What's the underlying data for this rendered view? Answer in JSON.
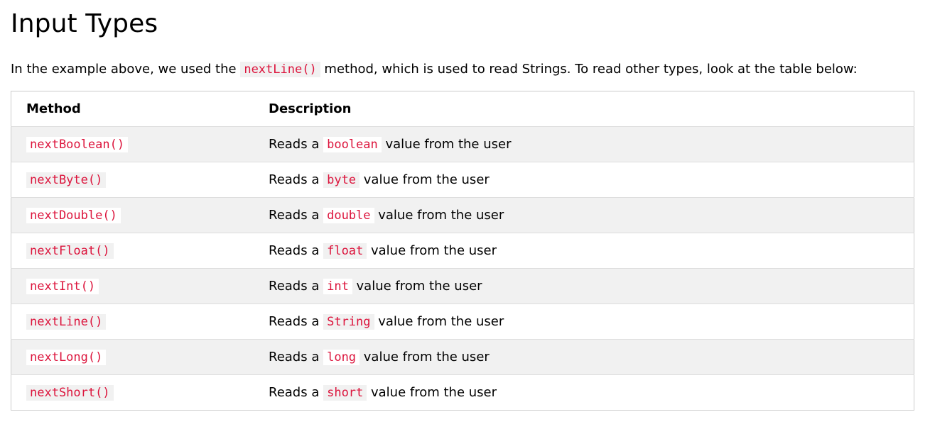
{
  "heading": "Input Types",
  "intro": {
    "before": "In the example above, we used the ",
    "code": "nextLine()",
    "after": " method, which is used to read Strings. To read other types, look at the table below:"
  },
  "table": {
    "headers": [
      "Method",
      "Description"
    ],
    "rows": [
      {
        "method": "nextBoolean()",
        "desc_prefix": "Reads a ",
        "type": "boolean",
        "desc_suffix": " value from the user"
      },
      {
        "method": "nextByte()",
        "desc_prefix": "Reads a ",
        "type": "byte",
        "desc_suffix": " value from the user"
      },
      {
        "method": "nextDouble()",
        "desc_prefix": "Reads a ",
        "type": "double",
        "desc_suffix": " value from the user"
      },
      {
        "method": "nextFloat()",
        "desc_prefix": "Reads a ",
        "type": "float",
        "desc_suffix": " value from the user"
      },
      {
        "method": "nextInt()",
        "desc_prefix": "Reads a ",
        "type": "int",
        "desc_suffix": " value from the user"
      },
      {
        "method": "nextLine()",
        "desc_prefix": "Reads a ",
        "type": "String",
        "desc_suffix": " value from the user"
      },
      {
        "method": "nextLong()",
        "desc_prefix": "Reads a ",
        "type": "long",
        "desc_suffix": " value from the user"
      },
      {
        "method": "nextShort()",
        "desc_prefix": "Reads a ",
        "type": "short",
        "desc_suffix": " value from the user"
      }
    ]
  },
  "colors": {
    "code_text": "#dc143c",
    "code_bg": "#f1f1f1",
    "stripe": "#f1f1f1",
    "border": "#cccccc"
  }
}
